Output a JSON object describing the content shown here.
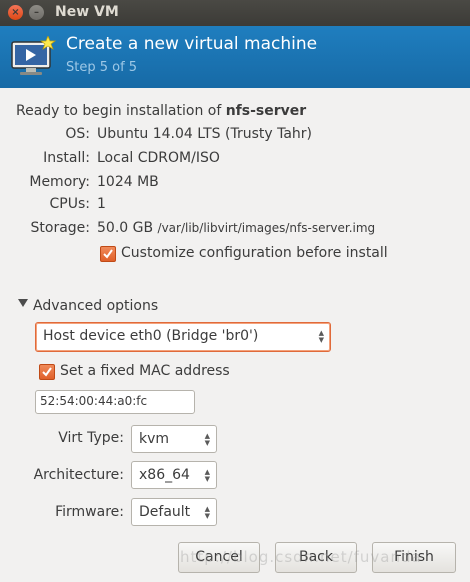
{
  "window": {
    "title": "New VM",
    "close_glyph": "×",
    "minimize_glyph": "–"
  },
  "header": {
    "title": "Create a new virtual machine",
    "step": "Step 5 of 5",
    "icon": "computer-monitor-star-icon"
  },
  "summary": {
    "ready_prefix": "Ready to begin installation of ",
    "vm_name": "nfs-server",
    "rows": [
      {
        "label": "OS:",
        "value": "Ubuntu 14.04 LTS (Trusty Tahr)"
      },
      {
        "label": "Install:",
        "value": "Local CDROM/ISO"
      },
      {
        "label": "Memory:",
        "value": "1024 MB"
      },
      {
        "label": "CPUs:",
        "value": "1"
      },
      {
        "label": "Storage:",
        "value_main": "50.0 GB",
        "value_path": "/var/lib/libvirt/images/nfs-server.img"
      }
    ],
    "customize_label": "Customize configuration before install",
    "customize_checked": true
  },
  "advanced": {
    "toggle_label": "Advanced options",
    "network_selected": "Host device eth0 (Bridge 'br0')",
    "mac_label": "Set a fixed MAC address",
    "mac_checked": true,
    "mac_value": "52:54:00:44:a0:fc",
    "virt_type_label": "Virt Type:",
    "virt_type_value": "kvm",
    "arch_label": "Architecture:",
    "arch_value": "x86_64",
    "firmware_label": "Firmware:",
    "firmware_value": "Default"
  },
  "buttons": {
    "cancel": "Cancel",
    "back": "Back",
    "finish": "Finish"
  },
  "watermark": "http://blog.csdn.net/fuvanda",
  "colors": {
    "banner": "#1a74b4",
    "accent_orange": "#e0602a",
    "titlebar": "#3c3b37"
  }
}
